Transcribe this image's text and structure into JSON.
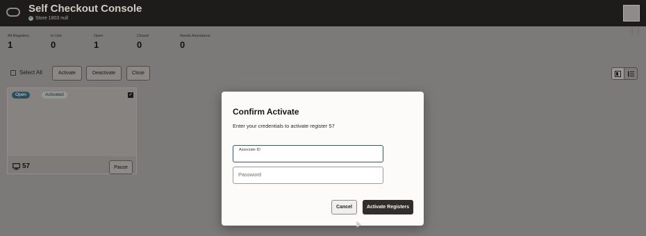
{
  "header": {
    "title": "Self Checkout Console",
    "store": "Store 1803 null"
  },
  "stats": [
    {
      "label": "All Registers",
      "value": "1"
    },
    {
      "label": "In Use",
      "value": "0"
    },
    {
      "label": "Open",
      "value": "1"
    },
    {
      "label": "Closed",
      "value": "0"
    },
    {
      "label": "Needs Assistance",
      "value": "0"
    }
  ],
  "toolbar": {
    "select_all": "Select All",
    "activate": "Activate",
    "deactivate": "Deactivate",
    "close": "Close"
  },
  "register_card": {
    "status_badge": "Open",
    "activation_badge": "Activated",
    "number": "57",
    "pause": "Pause"
  },
  "modal": {
    "title": "Confirm Activate",
    "message": "Enter your credentials to activate register 57",
    "associate_label": "Associate ID",
    "associate_value": "",
    "password_placeholder": "Password",
    "cancel": "Cancel",
    "confirm": "Activate Registers"
  },
  "colors": {
    "header_bg": "#1e1c1a",
    "primary_button": "#312d2a",
    "open_badge": "#2e4f5a",
    "focus_border": "#2e5a66"
  }
}
